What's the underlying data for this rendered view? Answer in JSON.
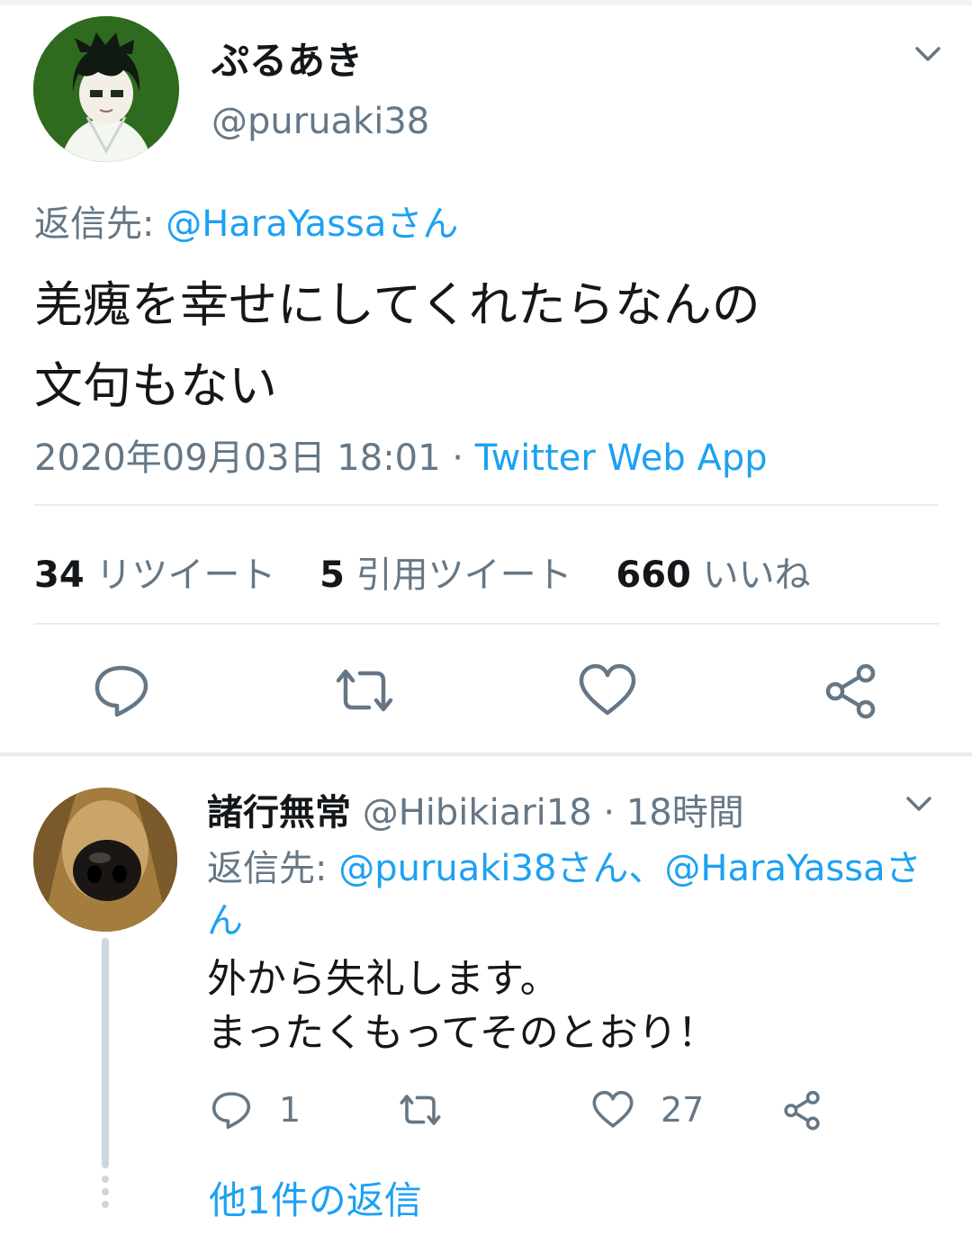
{
  "main": {
    "display_name": "ぷるあき",
    "handle": "@puruaki38",
    "reply_prefix": "返信先: ",
    "reply_to": "@HaraYassaさん",
    "text_line1": "羌瘣を幸せにしてくれたらなんの",
    "text_line2": "文句もない",
    "timestamp": "2020年09月03日 18:01",
    "meta_separator": " · ",
    "app": "Twitter Web App",
    "stats": {
      "retweets_count": "34",
      "retweets_label": "リツイート",
      "quotes_count": "5",
      "quotes_label": "引用ツイート",
      "likes_count": "660",
      "likes_label": "いいね"
    },
    "icons": [
      "reply-icon",
      "retweet-icon",
      "like-icon",
      "share-icon",
      "chevron-down-icon"
    ]
  },
  "reply": {
    "display_name": "諸行無常",
    "handle": "@Hibikiari18",
    "time": " · 18時間",
    "reply_prefix": "返信先: ",
    "reply_to": "@puruaki38さん、@HaraYassaさん",
    "text_line1": "外から失礼します。",
    "text_line2": "まったくもってそのとおり！",
    "reply_count": "1",
    "like_count": "27",
    "more_replies": "他1件の返信"
  },
  "colors": {
    "accent": "#1da1f2",
    "text": "#14171a",
    "secondary": "#657786",
    "divider": "#e6ecf0"
  }
}
